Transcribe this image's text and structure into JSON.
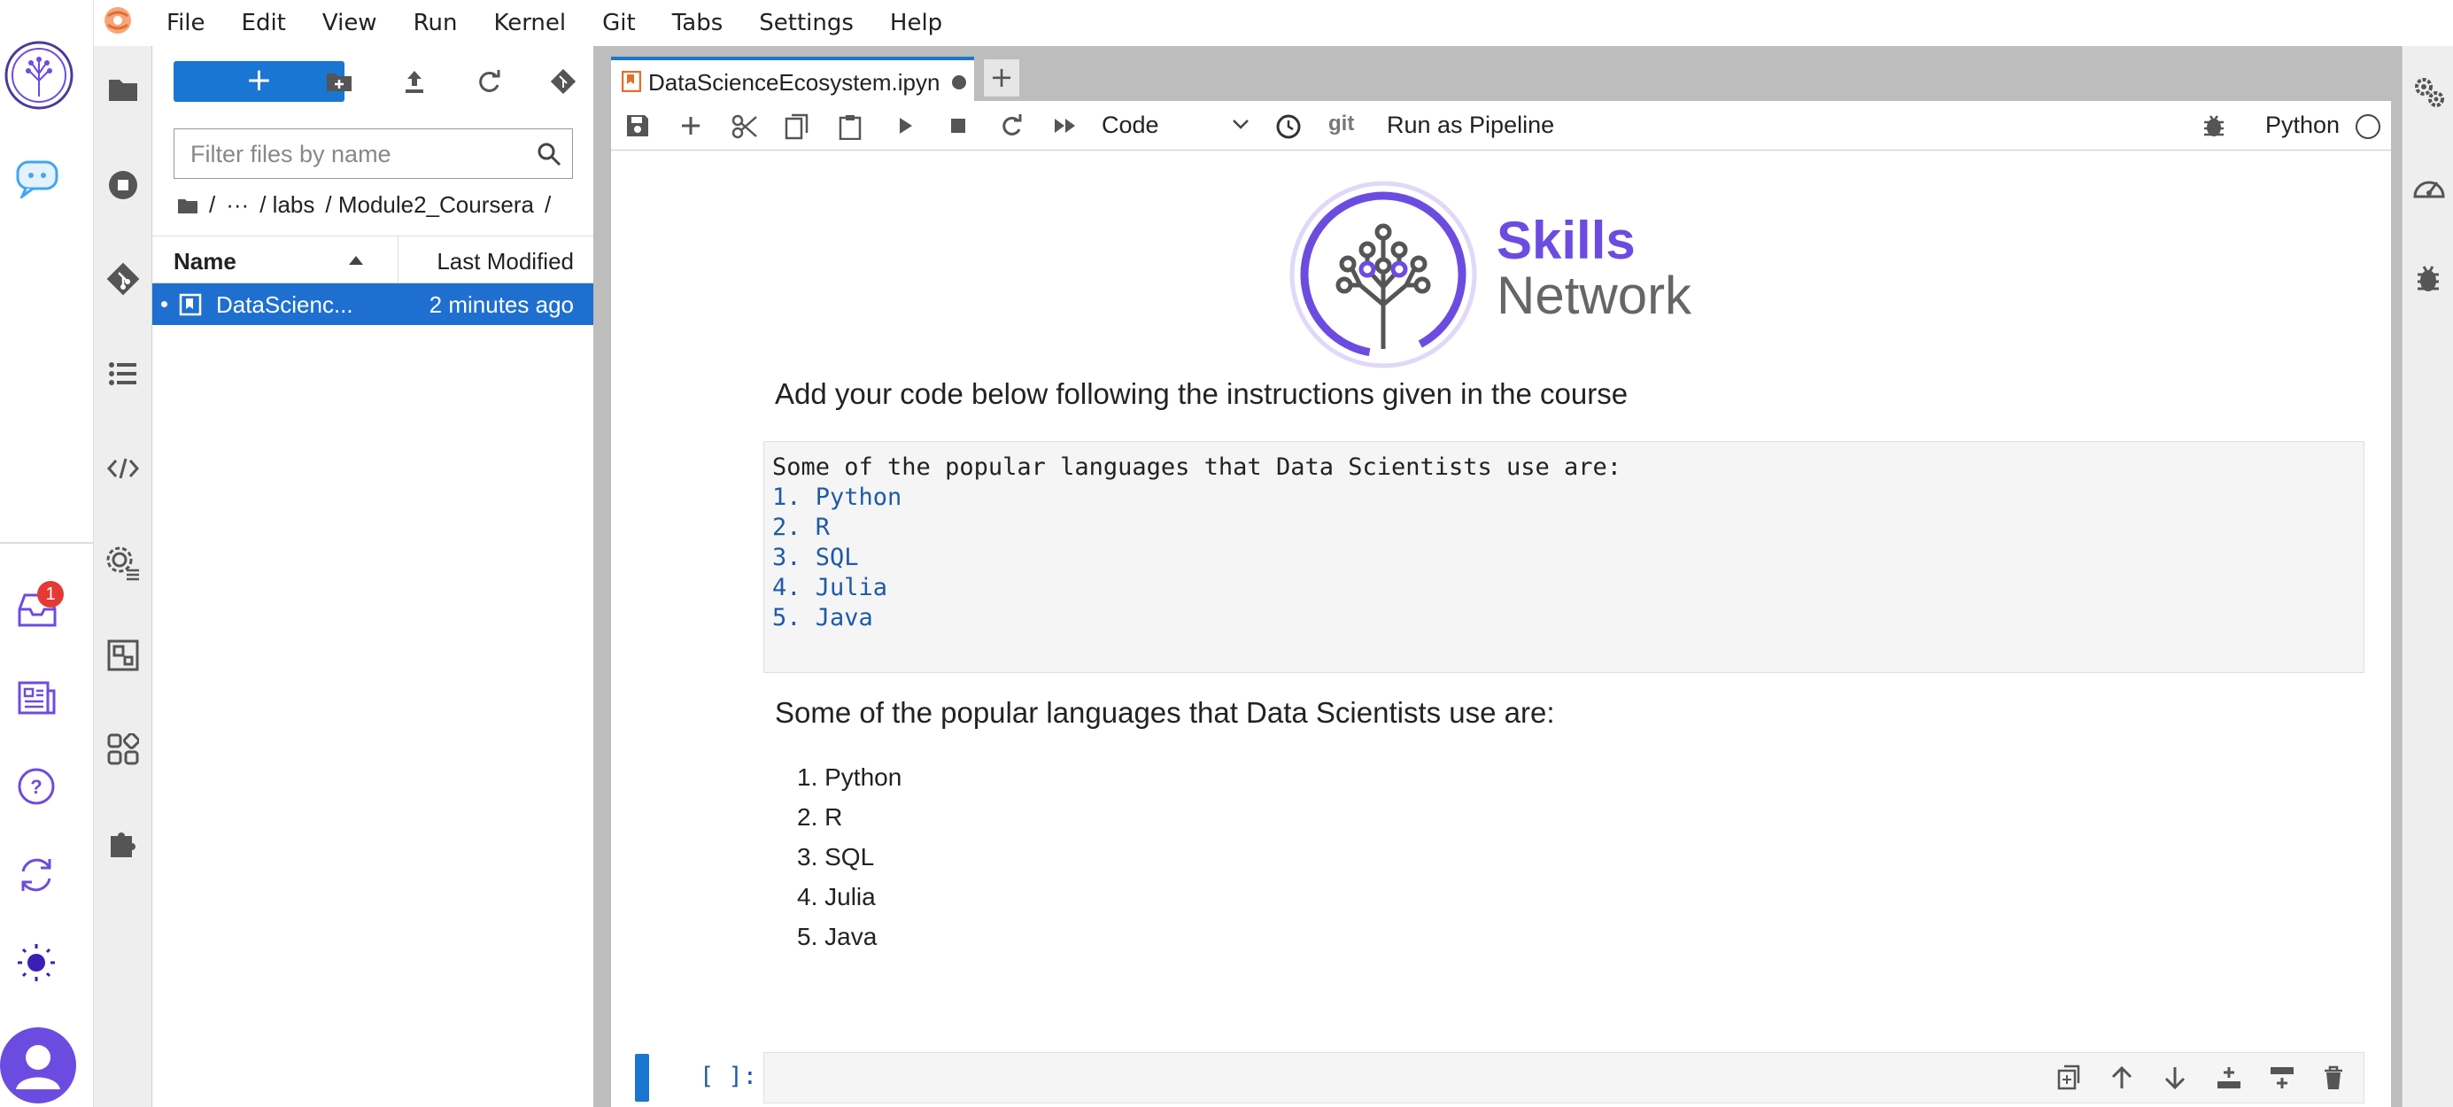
{
  "menubar": {
    "items": [
      "File",
      "Edit",
      "View",
      "Run",
      "Kernel",
      "Git",
      "Tabs",
      "Settings",
      "Help"
    ]
  },
  "left_rail": {
    "icons": [
      "skills-network-logo-icon",
      "chatbot-icon",
      "inbox-icon",
      "news-icon",
      "help-icon",
      "sync-icon",
      "theme-icon",
      "user-icon"
    ],
    "inbox_badge": "1"
  },
  "side_rail": {
    "icons": [
      "folder-icon",
      "running-icon",
      "git-icon",
      "toc-icon",
      "code-icon",
      "property-inspector-icon",
      "extension-manager-icon",
      "components-icon",
      "puzzle-icon"
    ]
  },
  "file_browser": {
    "new_label": "+",
    "filter_placeholder": "Filter files by name",
    "breadcrumb": [
      "/",
      "···",
      "/ labs",
      "/ Module2_Coursera",
      "/"
    ],
    "col_name": "Name",
    "col_modified": "Last Modified",
    "files": [
      {
        "name": "DataScienc...",
        "modified": "2 minutes ago"
      }
    ]
  },
  "tab": {
    "title": "DataScienceEcosystem.ipyn",
    "add_label": "+"
  },
  "toolbar": {
    "cell_type": "Code",
    "git_label": "git",
    "pipeline_label": "Run as Pipeline",
    "kernel_name": "Python"
  },
  "logo": {
    "line1": "Skills",
    "line2": "Network"
  },
  "notebook": {
    "heading": "Add your code below following the instructions given in the course",
    "code_cell": {
      "first_line": "Some of the popular languages that Data Scientists use are:",
      "items": [
        "1. Python",
        "2. R",
        "3. SQL",
        "4. Julia",
        "5. Java"
      ]
    },
    "markdown_intro": "Some of the popular languages that Data Scientists use are:",
    "markdown_list": [
      "1. Python",
      "2. R",
      "3. SQL",
      "4. Julia",
      "5. Java"
    ],
    "empty_prompt": "[ ]:"
  },
  "colors": {
    "accent": "#1976d2",
    "brand_purple": "#6c4ce0",
    "code_blue": "#1e5aa8"
  }
}
